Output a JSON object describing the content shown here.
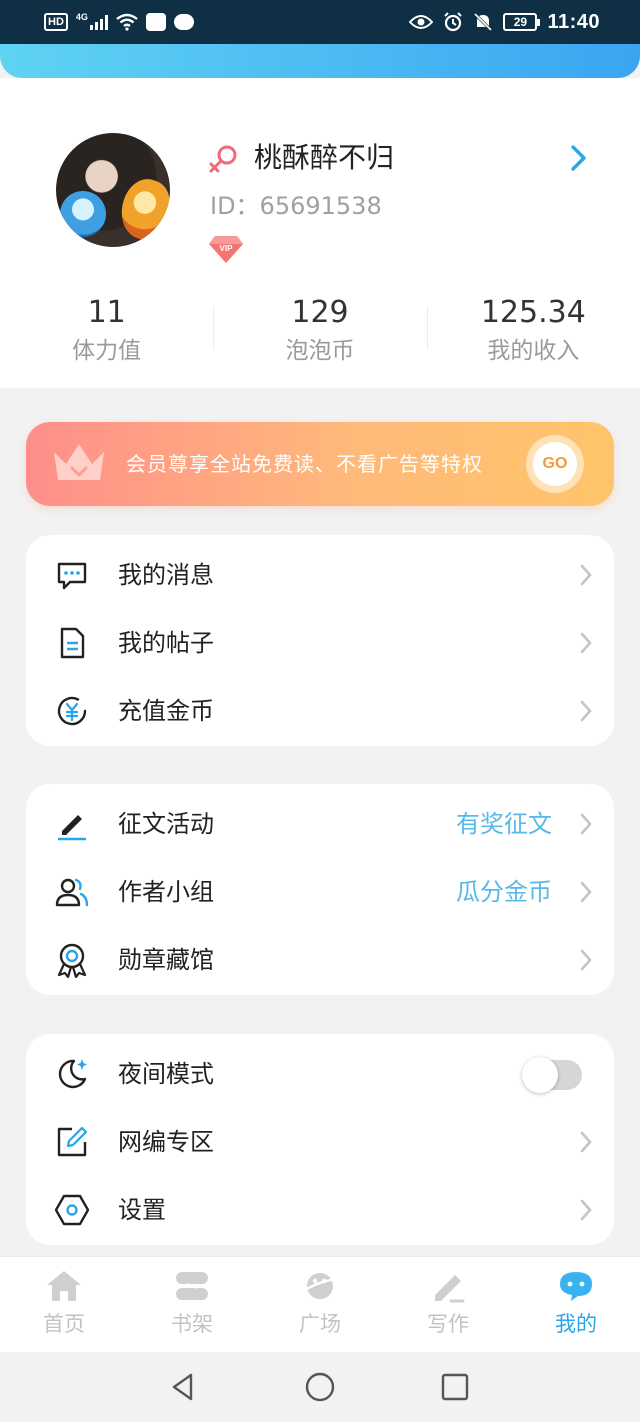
{
  "status_bar": {
    "hd": "HD",
    "network": "4G",
    "battery": "29",
    "time": "11:40"
  },
  "profile": {
    "username": "桃酥醉不归",
    "user_id": "ID：65691538",
    "vip_badge": "VIP",
    "stats": [
      {
        "value": "11",
        "label": "体力值"
      },
      {
        "value": "129",
        "label": "泡泡币"
      },
      {
        "value": "125.34",
        "label": "我的收入"
      }
    ]
  },
  "vip_banner": {
    "text": "会员尊享全站免费读、不看广告等特权",
    "button": "GO"
  },
  "menu_group_1": [
    {
      "label": "我的消息",
      "icon": "message-icon"
    },
    {
      "label": "我的帖子",
      "icon": "document-icon"
    },
    {
      "label": "充值金币",
      "icon": "yuan-coin-icon"
    }
  ],
  "menu_group_2": [
    {
      "label": "征文活动",
      "tag": "有奖征文",
      "icon": "pen-icon"
    },
    {
      "label": "作者小组",
      "tag": "瓜分金币",
      "icon": "users-icon"
    },
    {
      "label": "勋章藏馆",
      "icon": "medal-icon"
    }
  ],
  "menu_group_3": [
    {
      "label": "夜间模式",
      "icon": "moon-icon",
      "toggle": "off"
    },
    {
      "label": "网编专区",
      "icon": "edit-box-icon"
    },
    {
      "label": "设置",
      "icon": "settings-hex-icon"
    }
  ],
  "tab_bar": [
    {
      "label": "首页",
      "icon": "home-icon"
    },
    {
      "label": "书架",
      "icon": "bookshelf-icon"
    },
    {
      "label": "广场",
      "icon": "planet-icon"
    },
    {
      "label": "写作",
      "icon": "write-icon"
    },
    {
      "label": "我的",
      "icon": "chat-bubble-icon",
      "active": true
    }
  ],
  "colors": {
    "accent": "#2aa6e8",
    "tag_text": "#58b8e8",
    "status_bar_bg": "#0f2f45",
    "vip_gradient_start": "#ff8e8a",
    "vip_gradient_end": "#ffc46a"
  }
}
